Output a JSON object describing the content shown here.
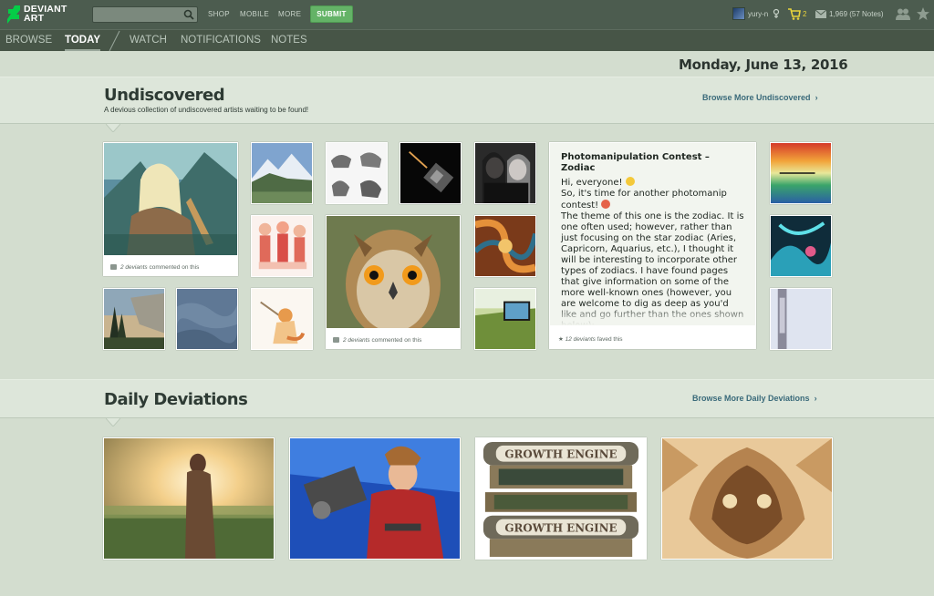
{
  "topbar": {
    "logo_line1": "DEVIANT",
    "logo_line2": "ART",
    "search_placeholder": "",
    "links": [
      "SHOP",
      "MOBILE",
      "MORE"
    ],
    "submit_label": "SUBMIT",
    "username": "yury-n",
    "cart_count": "2",
    "notes": "1,969 (57 Notes)"
  },
  "subnav": {
    "tabs": [
      "BROWSE",
      "TODAY",
      "WATCH",
      "NOTIFICATIONS",
      "NOTES"
    ],
    "active": "TODAY"
  },
  "date": "Monday, June 13, 2016",
  "undiscovered": {
    "title": "Undiscovered",
    "subtitle": "A devious collection of undiscovered artists waiting to be found!",
    "browse_label": "Browse More Undiscovered",
    "card1_meta_count": "2 deviants",
    "card1_meta_text": "commented on this",
    "card2_meta_count": "2 deviants",
    "card2_meta_text": "commented on this",
    "lit": {
      "title": "Photomanipulation Contest – Zodiac",
      "greeting": "Hi, everyone!",
      "line2": "So, it's time for another photomanip contest!",
      "body": "The theme of this one is the zodiac. It is one often used; however, rather than just focusing on the star zodiac (Aries, Capricorn, Aquarius, etc.), I thought it will be interesting to incorporate other types of zodiacs. I have found pages that give information on some of the more well-known ones (however, you are welcome to dig as deep as you'd like and go further than the ones shown below):",
      "faved_count": "12 deviants",
      "faved_text": "faved this"
    }
  },
  "daily": {
    "title": "Daily Deviations",
    "browse_label": "Browse More Daily Deviations",
    "growth_engine_text": "GROWTH ENGINE"
  },
  "colors": {
    "topbar": "#4c5c4f",
    "subnav": "#475547",
    "page_bg": "#d3ddcf",
    "submit": "#64b367",
    "link": "#3a6a7a"
  },
  "icons": [
    "logo-icon",
    "search-icon",
    "gender-icon",
    "cart-icon",
    "mail-icon",
    "friends-icon",
    "star-icon",
    "chevron-right-icon",
    "comment-icon",
    "favorite-icon"
  ]
}
